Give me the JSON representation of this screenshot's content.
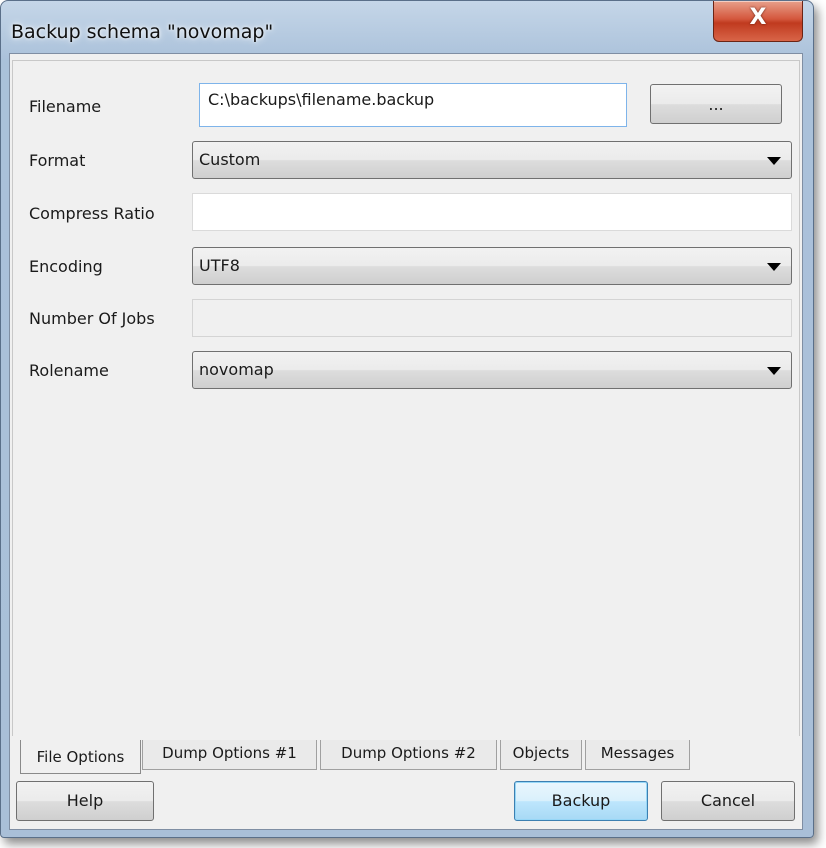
{
  "window": {
    "title": "Backup schema \"novomap\"",
    "close_label": "X"
  },
  "form": {
    "filename": {
      "label": "Filename",
      "value": "C:\\backups\\filename.backup",
      "browse_label": "..."
    },
    "format": {
      "label": "Format",
      "value": "Custom"
    },
    "compress_ratio": {
      "label": "Compress Ratio",
      "value": ""
    },
    "encoding": {
      "label": "Encoding",
      "value": "UTF8"
    },
    "number_of_jobs": {
      "label": "Number Of Jobs",
      "value": ""
    },
    "rolename": {
      "label": "Rolename",
      "value": "novomap"
    }
  },
  "tabs": [
    {
      "label": "File Options",
      "active": true
    },
    {
      "label": "Dump Options #1",
      "active": false
    },
    {
      "label": "Dump Options #2",
      "active": false
    },
    {
      "label": "Objects",
      "active": false
    },
    {
      "label": "Messages",
      "active": false
    }
  ],
  "buttons": {
    "help": "Help",
    "backup": "Backup",
    "cancel": "Cancel"
  }
}
